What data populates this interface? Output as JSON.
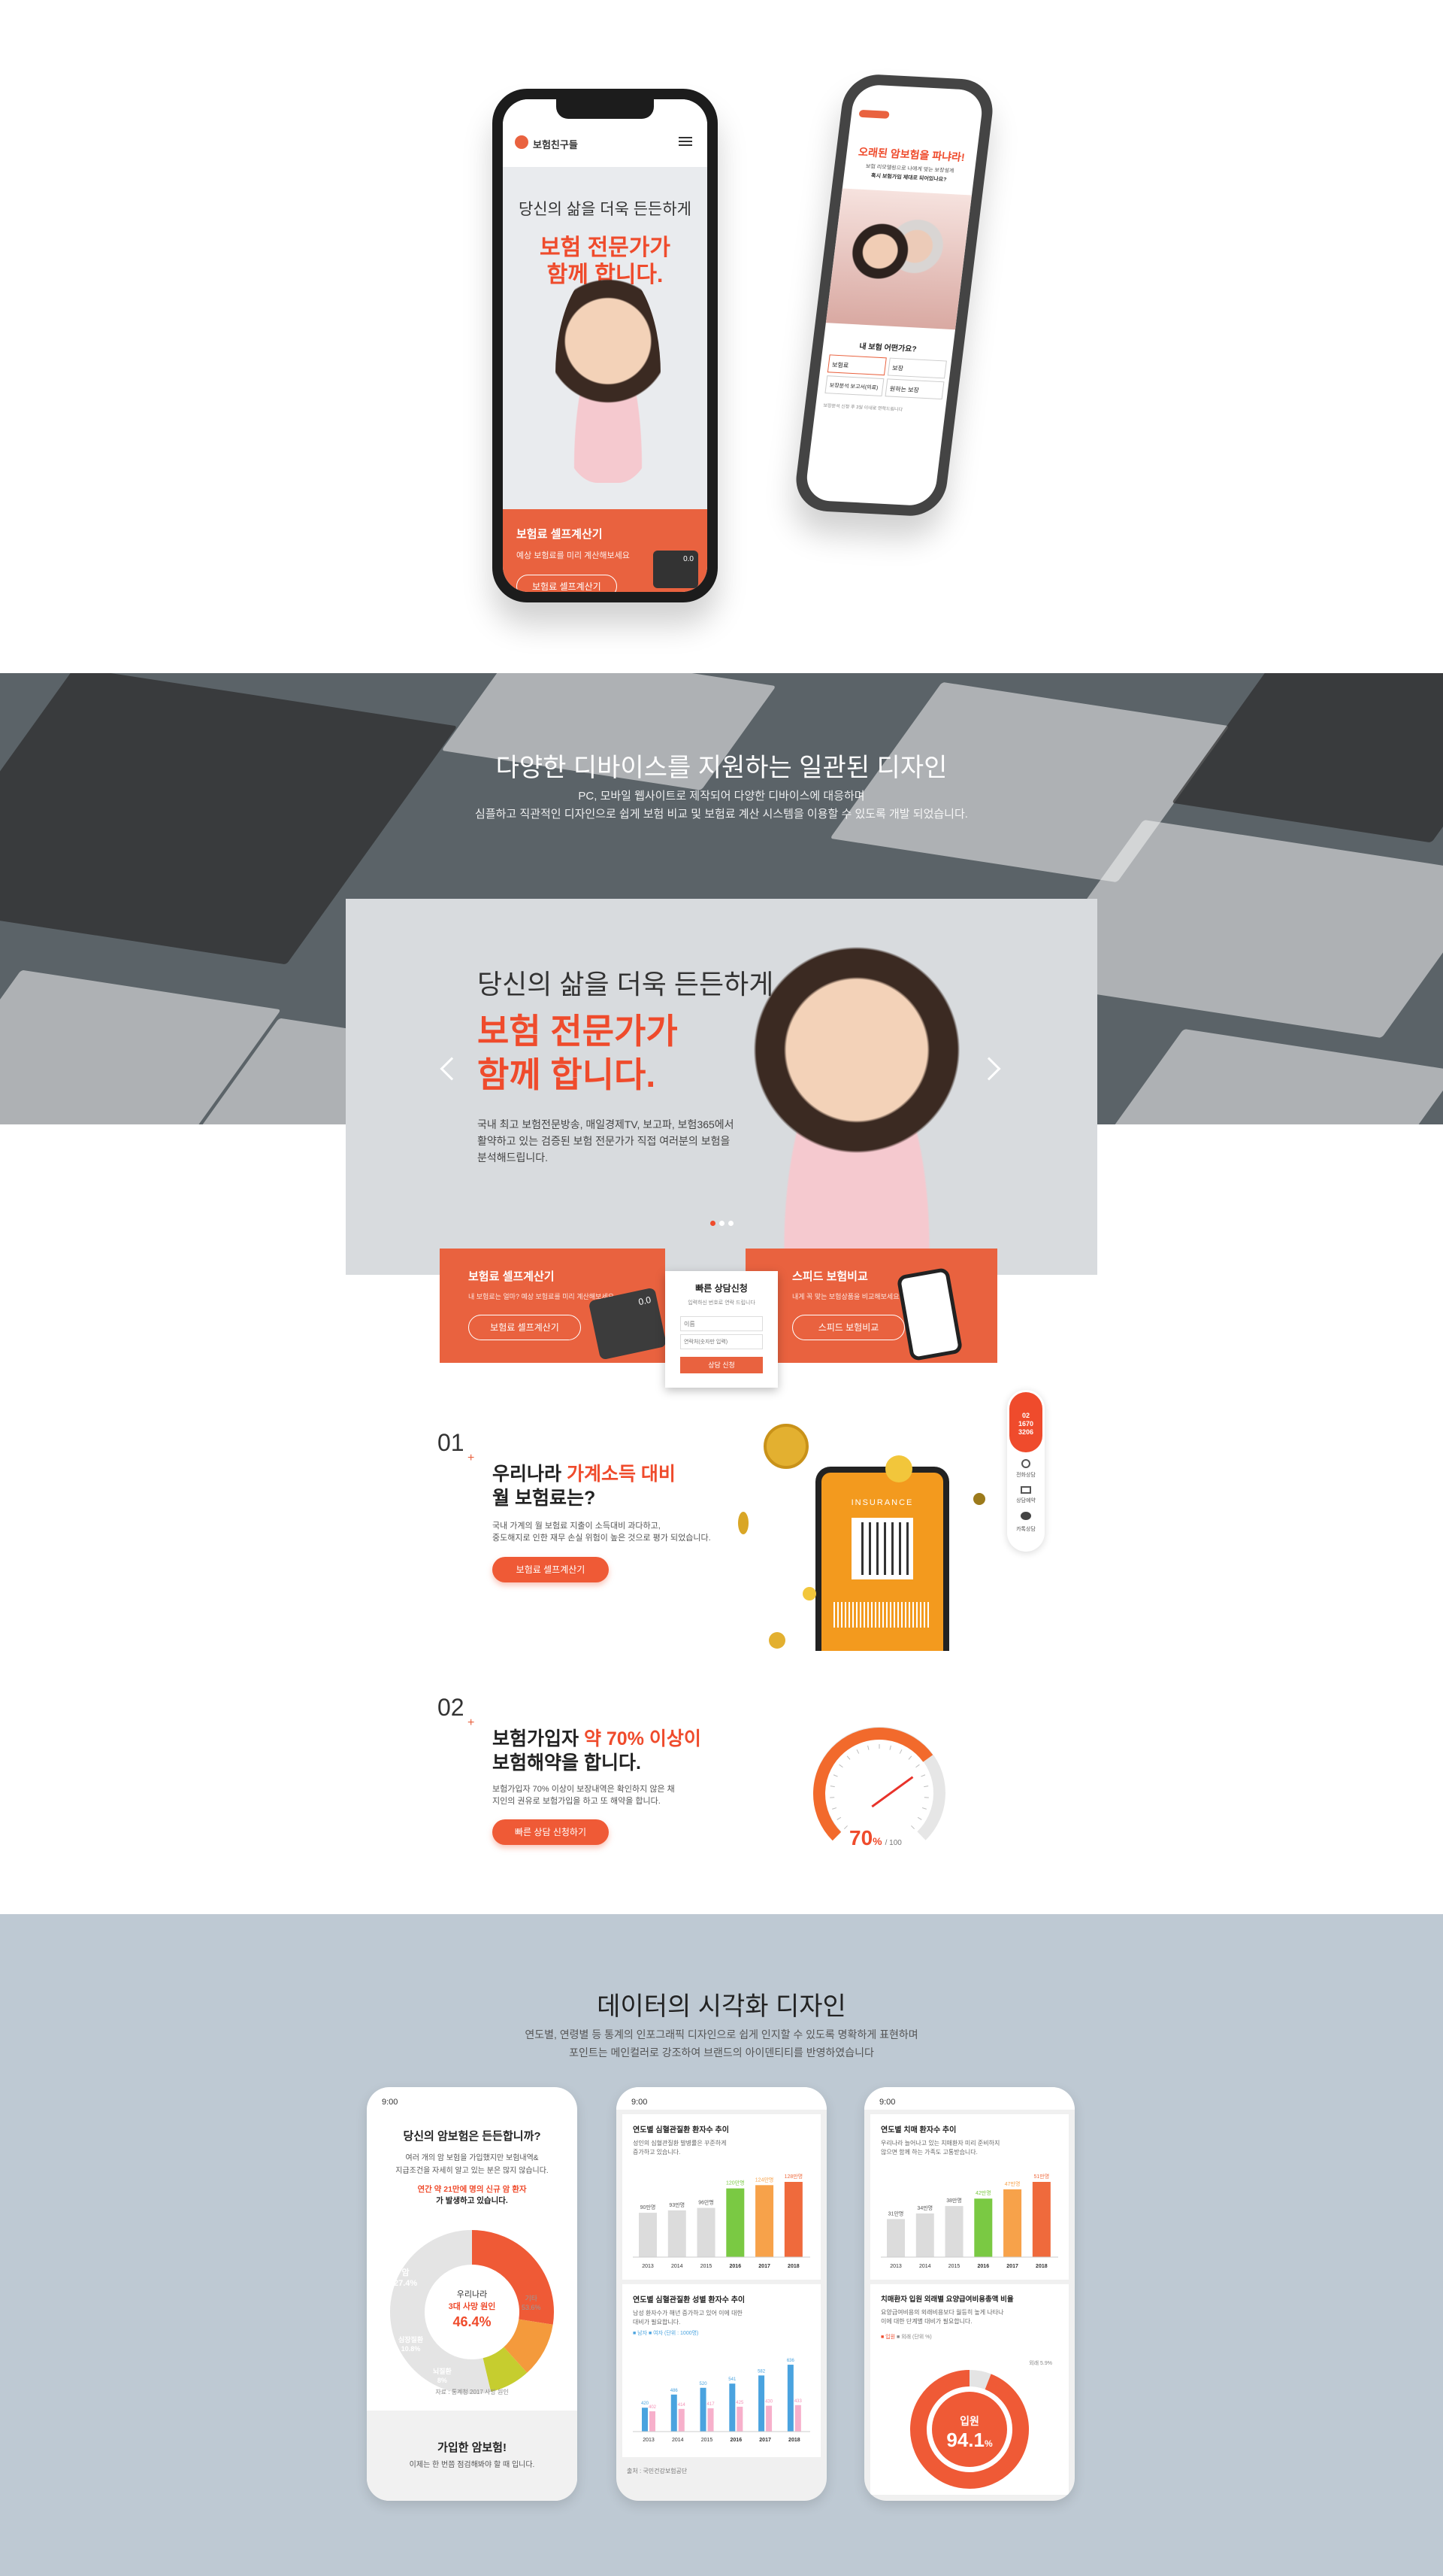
{
  "top_phones": {
    "left": {
      "logo": "보험친구들",
      "headline": "당신의 삶을 더욱 든든하게",
      "headline_em_1": "보험 전문가가",
      "headline_em_2": "함께 합니다.",
      "card_title": "보험료 셀프계산기",
      "card_desc": "예상 보험료를 미리 계산해보세요",
      "card_button": "보험료 셀프계산기",
      "calc_display": "0.0"
    },
    "right": {
      "banner_1": "오래된 암보험을 파냐라!",
      "banner_2": "보험 리모델링으로 나에게 맞는 보장설계",
      "banner_3": "혹시 보험가입 제대로 되어있나요?",
      "question": "내 보험 어떤가요?",
      "opt_1": "보험료",
      "opt_2": "보장",
      "opt_3": "보장분석 보고서(의료)",
      "opt_4": "원하는 보장",
      "note": "보장분석 신청 후 3일 이내로 연락드립니다"
    }
  },
  "devices": {
    "title": "다양한 디바이스를 지원하는 일관된 디자인",
    "desc_1": "PC, 모바일 웹사이트로 제작되어 다양한 디바이스에 대응하며",
    "desc_2": "심플하고 직관적인 디자인으로 쉽게 보험 비교 및 보험료 계산 시스템을 이용할 수 있도록 개발 되었습니다."
  },
  "hero": {
    "line_1": "당신의 삶을 더욱 든든하게",
    "em_1": "보험 전문가가",
    "em_2": "함께 합니다.",
    "desc_1": "국내 최고 보험전문방송, 매일경제TV, 보고파, 보험365에서",
    "desc_2": "활약하고 있는 검증된 보험 전문가가 직접 여러분의 보험을",
    "desc_3": "분석해드립니다."
  },
  "cards": {
    "calc": {
      "title": "보험료 셀프계산기",
      "desc": "내 보험료는 얼마? 예상 보험료를 미리 계산해보세요",
      "button": "보험료 셀프계산기",
      "display": "0.0"
    },
    "compare": {
      "title": "스피드 보험비교",
      "desc": "내게 꼭 맞는 보험상품을 비교해보세요",
      "button": "스피드 보험비교"
    },
    "consult": {
      "title": "빠른 상담신청",
      "desc": "입력하신 번호로 연락 드립니다",
      "name_placeholder": "이름",
      "phone_placeholder": "연락처(숫자만 입력)",
      "button": "상담 신청"
    }
  },
  "side_bar": {
    "phone_1": "02",
    "phone_2": "1670",
    "phone_3": "3206",
    "item_1": "전화상담",
    "item_2": "상담예약",
    "item_3": "카톡상담"
  },
  "sec01": {
    "num": "01",
    "title_1": "우리나라 ",
    "title_em": "가계소득 대비",
    "title_2": "월 보험료는?",
    "desc_1": "국내 가계의 월 보험료 지출이 소득대비 과다하고,",
    "desc_2": "중도해지로 인한 재무 손실 위험이 높은 것으로 평가 되었습니다.",
    "button": "보험료 셀프계산기",
    "phone_label": "INSURANCE"
  },
  "sec02": {
    "num": "02",
    "title_1": "보험가입자 ",
    "title_em": "약 70% 이상이",
    "title_2": "보험해약을 합니다.",
    "desc_1": "보험가입자 70% 이상이 보장내역은 확인하지 않은 채",
    "desc_2": "지인의 권유로 보험가입을 하고 또 해약을 합니다.",
    "button": "빠른 상담 신청하기",
    "gauge_value": "70",
    "gauge_unit": "%",
    "gauge_max": "/ 100",
    "gauge_fraction": 0.7
  },
  "data_sec": {
    "title": "데이터의 시각화 디자인",
    "desc_1": "연도별, 연령별 등 통계의 인포그래픽 디자인으로 쉽게 인지할 수 있도록 명확하게 표현하며",
    "desc_2": "포인트는 메인컬러로 강조하여 브랜드의 아이덴티티를 반영하였습니다"
  },
  "phone_a": {
    "time": "9:00",
    "title": "당신의 암보험은 든든합니까?",
    "desc_1": "여러 개의 암 보험을 가입했지만 보험내역&",
    "desc_2": "지급조건을 자세히 알고 있는 분은 많지 않습니다.",
    "stat_1": "연간 약 21만에 명의 신규 암 환자",
    "stat_2": "가 발생하고 있습니다.",
    "donut_center_1": "우리나라",
    "donut_center_2": "3대 사망 원인",
    "donut_center_3": "46.4%",
    "seg_1_label": "암",
    "seg_1_value": "27.4%",
    "seg_2_label": "심장질환",
    "seg_2_value": "10.8%",
    "seg_3_label": "뇌질환",
    "seg_3_value": "8%",
    "seg_4_label": "기타",
    "seg_4_value": "53.6%",
    "source": "자료 : 통계청 2017 사망 원인",
    "footer_1": "가입한 암보험!",
    "footer_2": "이제는 한 번쯤 점검해봐야 할 때 입니다."
  },
  "phone_b": {
    "time": "9:00",
    "chart1_title": "연도별 심혈관질환 환자수 추이",
    "chart1_desc_1": "성인의 심혈관질환 발병률은 꾸준하게",
    "chart1_desc_2": "증가하고 있습니다.",
    "chart2_title": "연도별 심혈관질환 성별 환자수 추이",
    "chart2_desc_1": "남성 환자수가 해년 증가하고 있어 이에 대한",
    "chart2_desc_2": "대비가 필요합니다.",
    "legend": "■ 남자  ■ 여자  (단위 : 1000명)",
    "source": "출처 : 국민건강보험공단"
  },
  "phone_c": {
    "time": "9:00",
    "chart1_title": "연도별 치매 환자수 추이",
    "chart1_desc_1": "우리나라 늘어나고 있는 치매환자 미리 준비하지",
    "chart1_desc_2": "않으면 함께 하는 가족도 고통받습니다.",
    "chart2_title": "치매환자 입원 외래별 요양급여비용총액 비율",
    "chart2_desc_1": "요양급여비용의 외래비용보다 월등히 높게 나타나",
    "chart2_desc_2": "이에 대한 단계별 대비가 필요합니다.",
    "legend_in": "■ 입원",
    "legend_out": "■ 외래 (단위 %)",
    "out_label": "외래  5.9%",
    "donut_label": "입원",
    "donut_value": "94.1",
    "donut_unit": "%"
  },
  "chart_data": [
    {
      "type": "pie",
      "title": "우리나라 3대 사망 원인",
      "categories": [
        "암",
        "심장질환",
        "뇌질환",
        "기타"
      ],
      "values": [
        27.4,
        10.8,
        8,
        53.6
      ]
    },
    {
      "type": "bar",
      "title": "연도별 심혈관질환 환자수 추이",
      "categories": [
        "2013",
        "2014",
        "2015",
        "2016",
        "2017",
        "2018"
      ],
      "values": [
        90,
        93,
        96,
        120,
        124,
        128
      ],
      "value_labels": [
        "90만명",
        "93만명",
        "96만명",
        "120만명",
        "124만명",
        "128만명"
      ],
      "colors": [
        "#dcdcdc",
        "#dcdcdc",
        "#dcdcdc",
        "#7ac943",
        "#f7a24a",
        "#ef6a3c"
      ]
    },
    {
      "type": "bar",
      "title": "연도별 심혈관질환 성별 환자수 추이",
      "categories": [
        "2013",
        "2014",
        "2015",
        "2016",
        "2017",
        "2018"
      ],
      "series": [
        {
          "name": "남자",
          "values": [
            420,
            486,
            520,
            541,
            582,
            636
          ]
        },
        {
          "name": "여자",
          "values": [
            402,
            414,
            417,
            425,
            430,
            433
          ]
        }
      ]
    },
    {
      "type": "bar",
      "title": "연도별 치매 환자수 추이",
      "categories": [
        "2013",
        "2014",
        "2015",
        "2016",
        "2017",
        "2018"
      ],
      "values": [
        31,
        34,
        38,
        42,
        47,
        51
      ],
      "value_labels": [
        "31만명",
        "34만명",
        "38만명",
        "42만명",
        "47만명",
        "51만명"
      ],
      "colors": [
        "#dcdcdc",
        "#dcdcdc",
        "#dcdcdc",
        "#7ac943",
        "#f7a24a",
        "#ef6a3c"
      ]
    },
    {
      "type": "pie",
      "title": "치매환자 입원 외래별 요양급여비용총액 비율",
      "categories": [
        "입원",
        "외래"
      ],
      "values": [
        94.1,
        5.9
      ]
    }
  ],
  "colors": {
    "accent": "#e9623f",
    "accent_red": "#ef4b2c",
    "blue_bg": "#bec9d3",
    "dark_bg": "#5b6368"
  }
}
